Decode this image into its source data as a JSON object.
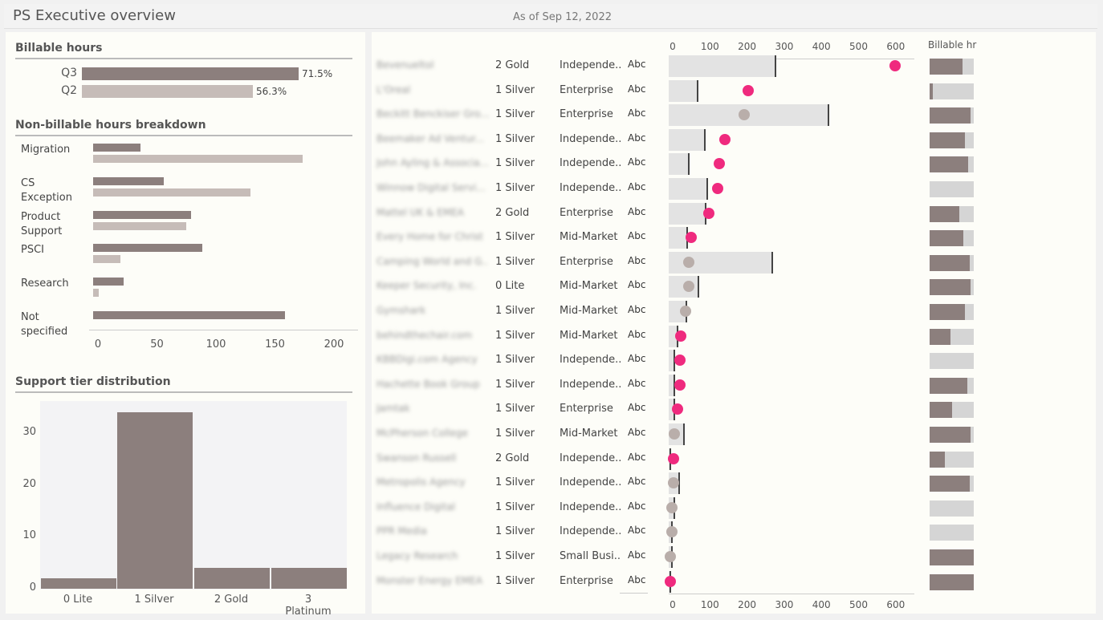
{
  "header": {
    "title": "PS Executive overview",
    "as_of": "As of Sep 12, 2022"
  },
  "billable": {
    "title": "Billable hours",
    "rows": [
      {
        "label": "Q3",
        "value": "71.5%",
        "pct": 71.5
      },
      {
        "label": "Q2",
        "value": "56.3%",
        "pct": 56.3
      }
    ]
  },
  "nonbillable": {
    "title": "Non-billable hours breakdown",
    "axis_ticks": [
      "0",
      "50",
      "100",
      "150",
      "200"
    ],
    "axis_max": 220,
    "rows": [
      {
        "label": "Migration",
        "q3": 40,
        "q2": 178
      },
      {
        "label": "CS Exception",
        "q3": 60,
        "q2": 134
      },
      {
        "label": "Product Support",
        "q3": 83,
        "q2": 79
      },
      {
        "label": "PSCI",
        "q3": 93,
        "q2": 23
      },
      {
        "label": "Research",
        "q3": 26,
        "q2": 5
      },
      {
        "label": "Not specified",
        "q3": 163,
        "q2": 0
      }
    ]
  },
  "tier": {
    "title": "Support tier distribution",
    "y_ticks": [
      "0",
      "10",
      "20",
      "30"
    ],
    "chart_data": {
      "type": "bar",
      "categories": [
        "0 Lite",
        "1 Silver",
        "2 Gold",
        "3 Platinum"
      ],
      "values": [
        2,
        34,
        4,
        4
      ],
      "ylim": [
        0,
        36
      ]
    }
  },
  "accounts": {
    "billable_header": "Billable hr",
    "axis_ticks": [
      "0",
      "100",
      "200",
      "300",
      "400",
      "500",
      "600"
    ],
    "axis_max": 640,
    "abc": "Abc",
    "rows": [
      {
        "name": "Bevenueltol",
        "tier": "2 Gold",
        "segment": "Independe..",
        "bar": 290,
        "dot": 615,
        "hot": true,
        "billable": 0.75
      },
      {
        "name": "L'Oreal",
        "tier": "1 Silver",
        "segment": "Enterprise",
        "bar": 78,
        "dot": 215,
        "hot": true,
        "billable": 0.07
      },
      {
        "name": "Beckitt Benckiser Gro...",
        "tier": "1 Silver",
        "segment": "Enterprise",
        "bar": 435,
        "dot": 205,
        "hot": false,
        "billable": 0.93
      },
      {
        "name": "Beemaker Ad Ventur...",
        "tier": "1 Silver",
        "segment": "Independe..",
        "bar": 98,
        "dot": 152,
        "hot": true,
        "billable": 0.8
      },
      {
        "name": "John Ayling & Associa...",
        "tier": "1 Silver",
        "segment": "Independe..",
        "bar": 55,
        "dot": 138,
        "hot": true,
        "billable": 0.87
      },
      {
        "name": "Winnow Digital Servi...",
        "tier": "1 Silver",
        "segment": "Independe..",
        "bar": 105,
        "dot": 133,
        "hot": true,
        "billable": 0.0
      },
      {
        "name": "Mattel UK & EMEA",
        "tier": "2 Gold",
        "segment": "Enterprise",
        "bar": 100,
        "dot": 108,
        "hot": true,
        "billable": 0.68
      },
      {
        "name": "Every Home for Christ",
        "tier": "1 Silver",
        "segment": "Mid-Market",
        "bar": 50,
        "dot": 60,
        "hot": true,
        "billable": 0.77
      },
      {
        "name": "Camping World and G...",
        "tier": "1 Silver",
        "segment": "Enterprise",
        "bar": 282,
        "dot": 55,
        "hot": false,
        "billable": 0.9
      },
      {
        "name": "Keeper Security, Inc.",
        "tier": "0 Lite",
        "segment": "Mid-Market",
        "bar": 80,
        "dot": 55,
        "hot": false,
        "billable": 0.93
      },
      {
        "name": "Gymshark",
        "tier": "1 Silver",
        "segment": "Mid-Market",
        "bar": 48,
        "dot": 45,
        "hot": false,
        "billable": 0.8
      },
      {
        "name": "behindthechair.com",
        "tier": "1 Silver",
        "segment": "Mid-Market",
        "bar": 25,
        "dot": 32,
        "hot": true,
        "billable": 0.47
      },
      {
        "name": "KBBDigi.com Agency",
        "tier": "1 Silver",
        "segment": "Independe..",
        "bar": 15,
        "dot": 30,
        "hot": true,
        "billable": 0.0
      },
      {
        "name": "Hachette Book Group",
        "tier": "1 Silver",
        "segment": "Independe..",
        "bar": 15,
        "dot": 30,
        "hot": true,
        "billable": 0.85
      },
      {
        "name": "Jamtak",
        "tier": "1 Silver",
        "segment": "Enterprise",
        "bar": 15,
        "dot": 25,
        "hot": true,
        "billable": 0.51
      },
      {
        "name": "McPherson College",
        "tier": "1 Silver",
        "segment": "Mid-Market",
        "bar": 42,
        "dot": 15,
        "hot": false,
        "billable": 0.93
      },
      {
        "name": "Swanson Russell",
        "tier": "2 Gold",
        "segment": "Independe..",
        "bar": 5,
        "dot": 12,
        "hot": true,
        "billable": 0.35
      },
      {
        "name": "Metropolis Agency",
        "tier": "1 Silver",
        "segment": "Independe..",
        "bar": 28,
        "dot": 12,
        "hot": false,
        "billable": 0.9
      },
      {
        "name": "Influence Digital",
        "tier": "1 Silver",
        "segment": "Independe..",
        "bar": 15,
        "dot": 8,
        "hot": false,
        "billable": 0.0
      },
      {
        "name": "PPR Media",
        "tier": "1 Silver",
        "segment": "Independe..",
        "bar": 8,
        "dot": 8,
        "hot": false,
        "billable": 0.0
      },
      {
        "name": "Legacy Research",
        "tier": "1 Silver",
        "segment": "Small Busi..",
        "bar": 8,
        "dot": 5,
        "hot": false,
        "billable": 1.0
      },
      {
        "name": "Monster Energy EMEA",
        "tier": "1 Silver",
        "segment": "Enterprise",
        "bar": 5,
        "dot": 5,
        "hot": true,
        "billable": 1.0
      }
    ]
  }
}
